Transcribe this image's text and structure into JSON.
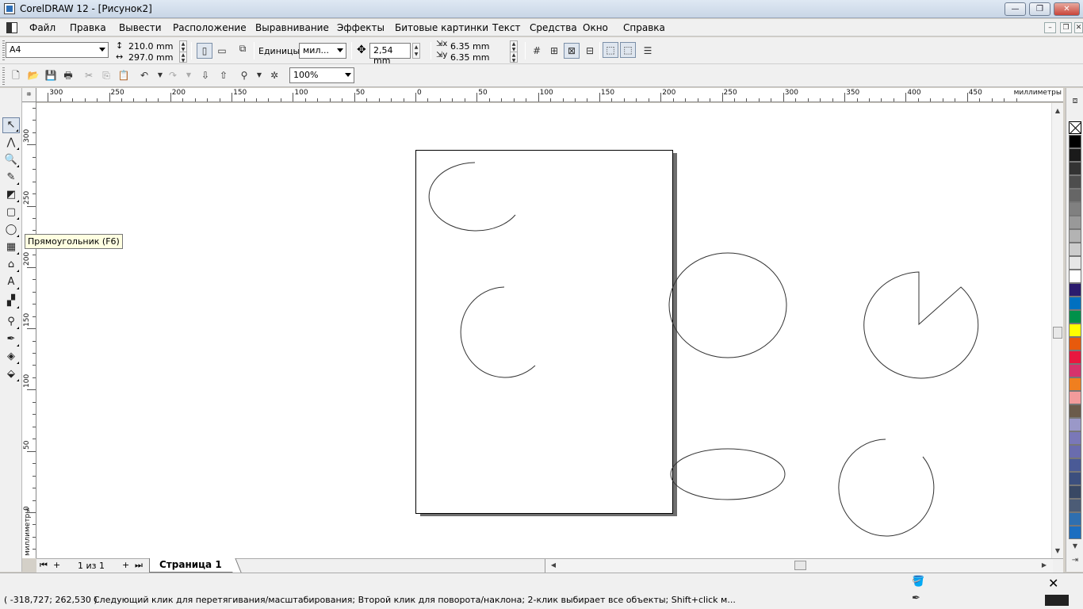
{
  "window": {
    "title": "CorelDRAW 12 - [Рисунок2]",
    "btn_minimize": "—",
    "btn_restore": "❐",
    "btn_close": "✕"
  },
  "menu": {
    "items": [
      "Файл",
      "Правка",
      "Вывести",
      "Расположение",
      "Выравнивание",
      "Эффекты",
      "Битовые картинки",
      "Текст",
      "Средства",
      "Окно",
      "Справка"
    ],
    "mdi_minimize": "–",
    "mdi_restore": "❐",
    "mdi_close": "✕"
  },
  "propbar": {
    "page_size": "A4",
    "width": "210.0 mm",
    "height": "297.0 mm",
    "units_label": "Единицы:",
    "units_value": "мил...",
    "nudge": "2,54 mm",
    "dup_x": "6.35 mm",
    "dup_y": "6.35 mm"
  },
  "stdbar": {
    "zoom": "100%"
  },
  "ruler": {
    "top_labels": [
      "300",
      "250",
      "200",
      "150",
      "100",
      "50",
      "0",
      "50",
      "100",
      "150",
      "200",
      "250",
      "300",
      "350",
      "400",
      "450"
    ],
    "top_unit": "миллиметры",
    "left_labels": [
      "300",
      "250",
      "200",
      "150",
      "100",
      "50",
      "0"
    ],
    "left_unit": "миллиметры"
  },
  "tooltip": "Прямоугольник (F6)",
  "pagebar": {
    "page_count": "1 из 1",
    "tab": "Страница 1",
    "first": "⏮",
    "add_before": "+",
    "add_after": "+",
    "last": "⏭"
  },
  "palette": {
    "colors": [
      "#000000",
      "#1a1a1a",
      "#333333",
      "#4d4d4d",
      "#666666",
      "#808080",
      "#999999",
      "#b3b3b3",
      "#cccccc",
      "#e6e6e6",
      "#ffffff",
      "#2b1b6e",
      "#0070c0",
      "#00914a",
      "#ffff00",
      "#e85a0c",
      "#e8173f",
      "#d6336c",
      "#f07f1f",
      "#f29b9b",
      "#6b5b4b",
      "#9a98c8",
      "#7a78b8",
      "#6a6cae",
      "#4a5a96",
      "#3c4f7e",
      "#394864",
      "#4c5c76",
      "#2f6fb0",
      "#1c6ec0"
    ]
  },
  "status": {
    "coords": "( -318,727; 262,530 )",
    "hint": "Следующий клик для перетягивания/масштабирования; Второй клик для поворота/наклона; 2-клик выбирает все объекты; Shift+click м..."
  }
}
